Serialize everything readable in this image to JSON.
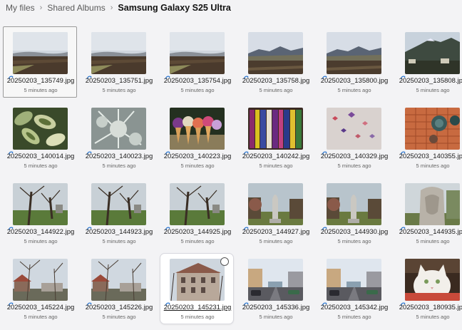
{
  "breadcrumb": {
    "items": [
      "My files",
      "Shared Albums",
      "Samsung Galaxy S25 Ultra"
    ]
  },
  "colors": {
    "accent": "#0a64c8",
    "selection_border": "#9a9a9a"
  },
  "files": [
    {
      "name": "20250203_135749.jpg",
      "meta": "5 minutes ago",
      "thumb": "landscape-field"
    },
    {
      "name": "20250203_135751.jpg",
      "meta": "5 minutes ago",
      "thumb": "landscape-field"
    },
    {
      "name": "20250203_135754.jpg",
      "meta": "5 minutes ago",
      "thumb": "landscape-field"
    },
    {
      "name": "20250203_135758.jpg",
      "meta": "5 minutes ago",
      "thumb": "landscape-mountains"
    },
    {
      "name": "20250203_135800.jpg",
      "meta": "5 minutes ago",
      "thumb": "landscape-mountains"
    },
    {
      "name": "20250203_135808.jpg",
      "meta": "5 minutes ago",
      "thumb": "mountain-town"
    },
    {
      "name": "20250203_140014.jpg",
      "meta": "5 minutes ago",
      "thumb": "plant-leaves"
    },
    {
      "name": "20250203_140023.jpg",
      "meta": "5 minutes ago",
      "thumb": "frost-pine"
    },
    {
      "name": "20250203_140223.jpg",
      "meta": "5 minutes ago",
      "thumb": "ice-cream"
    },
    {
      "name": "20250203_140242.jpg",
      "meta": "5 minutes ago",
      "thumb": "books"
    },
    {
      "name": "20250203_140329.jpg",
      "meta": "5 minutes ago",
      "thumb": "butterflies"
    },
    {
      "name": "20250203_140355.jpg",
      "meta": "5 minutes ago",
      "thumb": "basket"
    },
    {
      "name": "20250203_144922.jpg",
      "meta": "5 minutes ago",
      "thumb": "park-trees"
    },
    {
      "name": "20250203_144923.jpg",
      "meta": "5 minutes ago",
      "thumb": "park-trees"
    },
    {
      "name": "20250203_144925.jpg",
      "meta": "5 minutes ago",
      "thumb": "park-trees"
    },
    {
      "name": "20250203_144927.jpg",
      "meta": "5 minutes ago",
      "thumb": "park-statue"
    },
    {
      "name": "20250203_144930.jpg",
      "meta": "5 minutes ago",
      "thumb": "park-statue"
    },
    {
      "name": "20250203_144935.jpg",
      "meta": "5 minutes ago",
      "thumb": "statue-closeup"
    },
    {
      "name": "20250203_145224.jpg",
      "meta": "5 minutes ago",
      "thumb": "winter-houses"
    },
    {
      "name": "20250203_145226.jpg",
      "meta": "5 minutes ago",
      "thumb": "winter-houses"
    },
    {
      "name": "20250203_145231.jpg",
      "meta": "5 minutes ago",
      "thumb": "old-building"
    },
    {
      "name": "20250203_145336.jpg",
      "meta": "5 minutes ago",
      "thumb": "city-street"
    },
    {
      "name": "20250203_145342.jpg",
      "meta": "5 minutes ago",
      "thumb": "city-street"
    },
    {
      "name": "20250203_180935.jpg",
      "meta": "5 minutes ago",
      "thumb": "white-cat"
    }
  ]
}
